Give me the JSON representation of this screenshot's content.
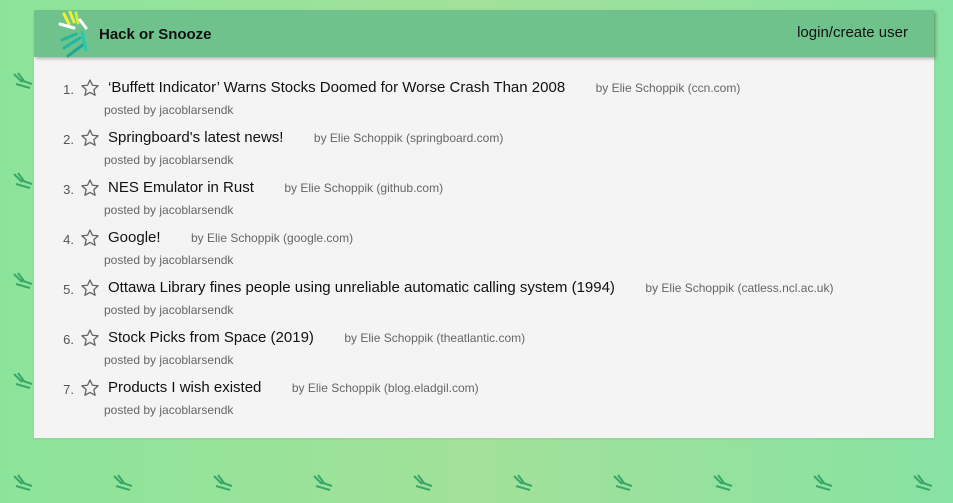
{
  "nav": {
    "brand": "Hack or Snooze",
    "login_label": "login/create user",
    "logo_icon": "leaf-logo-icon"
  },
  "stories": [
    {
      "num": "1.",
      "title": "‘Buffett Indicator’ Warns Stocks Doomed for Worse Crash Than 2008",
      "author": "by Elie Schoppik (ccn.com)",
      "posted_by": "posted by jacoblarsendk"
    },
    {
      "num": "2.",
      "title": "Springboard's latest news!",
      "author": "by Elie Schoppik (springboard.com)",
      "posted_by": "posted by jacoblarsendk"
    },
    {
      "num": "3.",
      "title": "NES Emulator in Rust",
      "author": "by Elie Schoppik (github.com)",
      "posted_by": "posted by jacoblarsendk"
    },
    {
      "num": "4.",
      "title": "Google!",
      "author": "by Elie Schoppik (google.com)",
      "posted_by": "posted by jacoblarsendk"
    },
    {
      "num": "5.",
      "title": "Ottawa Library fines people using unreliable automatic calling system (1994)",
      "author": "by Elie Schoppik (catless.ncl.ac.uk)",
      "posted_by": "posted by jacoblarsendk"
    },
    {
      "num": "6.",
      "title": "Stock Picks from Space (2019)",
      "author": "by Elie Schoppik (theatlantic.com)",
      "posted_by": "posted by jacoblarsendk"
    },
    {
      "num": "7.",
      "title": "Products I wish existed",
      "author": "by Elie Schoppik (blog.eladgil.com)",
      "posted_by": "posted by jacoblarsendk"
    }
  ],
  "colors": {
    "navbar": "#6fc28b",
    "page_bg": "#a2e19a",
    "panel": "#f4f4f4"
  },
  "icons": {
    "star": "star-outline-icon",
    "background": "leaf-pattern-icon"
  }
}
